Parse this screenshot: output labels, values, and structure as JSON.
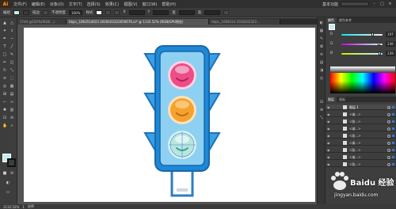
{
  "app": {
    "logo": "Ai",
    "menus": [
      "文件(F)",
      "编辑(E)",
      "对象(O)",
      "文字(T)",
      "选择(S)",
      "效果(C)",
      "视图(V)",
      "窗口(W)",
      "帮助(H)"
    ],
    "workspace": "基本功能",
    "window_buttons": [
      "-",
      "□",
      "×"
    ]
  },
  "controlbar": {
    "selection_label": "编组",
    "stroke_label": "描边",
    "opacity_label": "不透明度",
    "opacity_value": "100%",
    "style_label": "样式",
    "x_label": "X",
    "x_value": "",
    "y_label": "Y",
    "y_value": "",
    "w_label": "宽",
    "w_value": "",
    "h_label": "高",
    "h_value": ""
  },
  "tabs": [
    {
      "label": "1744 @102%(RGB/...)",
      "active": false
    },
    {
      "label": "hbjsc_1063514023 2018102322656676.ai* @ 1132.52% (RGB/GPU预览)",
      "active": true
    },
    {
      "label": "hbjsc_1068314 2018102322...",
      "active": false
    }
  ],
  "color_panel": {
    "tabs": [
      "颜色",
      "颜色参考"
    ],
    "sliders": [
      {
        "label": "R",
        "value": "197",
        "fraction": 0.77,
        "color": "#ff5555"
      },
      {
        "label": "G",
        "value": "236",
        "fraction": 0.93,
        "color": "#55dd55"
      },
      {
        "label": "B",
        "value": "239",
        "fraction": 0.94,
        "color": "#5588ff"
      }
    ],
    "accent": "#c5ecef"
  },
  "layers_panel": {
    "tabs": [
      "图层",
      "画板"
    ],
    "rows": [
      {
        "name": "图层 1",
        "top": true
      },
      {
        "name": "<编...>",
        "top": false
      },
      {
        "name": "<路...>",
        "top": false
      },
      {
        "name": "<编...>",
        "top": false
      },
      {
        "name": "<路...>",
        "top": false
      },
      {
        "name": "<编...>",
        "top": false
      },
      {
        "name": "<路...>",
        "top": false
      },
      {
        "name": "<编...>",
        "top": false
      },
      {
        "name": "<路...>",
        "top": false
      }
    ]
  },
  "statusbar": {
    "zoom": "1132.52%",
    "page": "1",
    "tool": "选择"
  },
  "watermark": {
    "brand": "Baidu 经验",
    "url": "jingyan.baidu.com"
  },
  "artwork": {
    "frame_color": "#1e88d6",
    "body_color": "#7fc8ee",
    "lights": [
      {
        "name": "red-light",
        "color": "#ee4d86"
      },
      {
        "name": "yellow-light",
        "color": "#f7a22f"
      },
      {
        "name": "green-light",
        "color": "#b8e6de"
      }
    ]
  }
}
